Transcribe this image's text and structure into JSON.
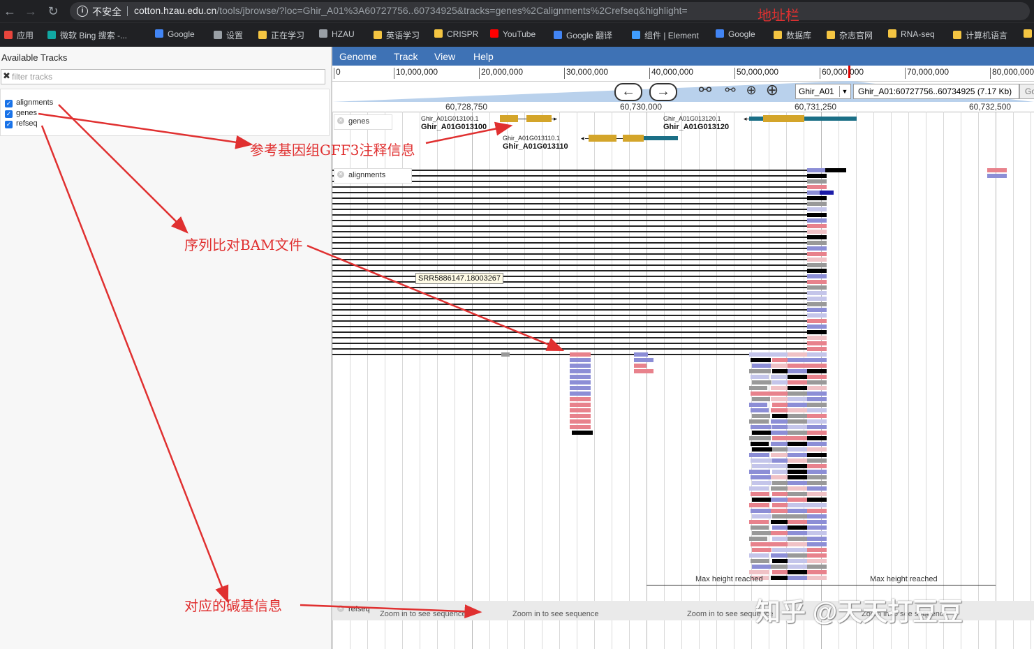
{
  "browser": {
    "security_label": "不安全",
    "url_host": "cotton.hzau.edu.cn",
    "url_rest": "/tools/jbrowse/?loc=Ghir_A01%3A60727756..60734925&tracks=genes%2Calignments%2Crefseq&highlight=",
    "bookmarks": [
      {
        "label": "应用",
        "icon": "apps-grid-icon",
        "color": "#e8453c"
      },
      {
        "label": "微软 Bing 搜索 -...",
        "icon": "bing-icon",
        "color": "#11a7a2"
      },
      {
        "label": "Google",
        "icon": "google-icon",
        "color": "#4285f4"
      },
      {
        "label": "设置",
        "icon": "gear-icon",
        "color": "#9aa0a6"
      },
      {
        "label": "正在学习",
        "icon": "folder-icon",
        "color": "#f4c542"
      },
      {
        "label": "HZAU",
        "icon": "globe-icon",
        "color": "#9aa0a6"
      },
      {
        "label": "英语学习",
        "icon": "folder-icon",
        "color": "#f4c542"
      },
      {
        "label": "CRISPR",
        "icon": "folder-icon",
        "color": "#f4c542"
      },
      {
        "label": "YouTube",
        "icon": "youtube-icon",
        "color": "#ff0000"
      },
      {
        "label": "Google 翻译",
        "icon": "translate-icon",
        "color": "#4285f4"
      },
      {
        "label": "组件 | Element",
        "icon": "element-icon",
        "color": "#409eff"
      },
      {
        "label": "Google",
        "icon": "google-icon",
        "color": "#4285f4"
      },
      {
        "label": "数据库",
        "icon": "folder-icon",
        "color": "#f4c542"
      },
      {
        "label": "杂志官网",
        "icon": "folder-icon",
        "color": "#f4c542"
      },
      {
        "label": "RNA-seq",
        "icon": "folder-icon",
        "color": "#f4c542"
      },
      {
        "label": "计算机语言",
        "icon": "folder-icon",
        "color": "#f4c542"
      }
    ]
  },
  "left_panel": {
    "title": "Available Tracks",
    "filter_placeholder": "filter tracks",
    "tracks": [
      {
        "label": "alignments",
        "checked": true
      },
      {
        "label": "genes",
        "checked": true
      },
      {
        "label": "refseq",
        "checked": true
      }
    ]
  },
  "menu": [
    "Genome",
    "Track",
    "View",
    "Help"
  ],
  "overview_ticks": [
    "0",
    "10,000,000",
    "20,000,000",
    "30,000,000",
    "40,000,000",
    "50,000,000",
    "60,000,000",
    "70,000,000",
    "80,000,000"
  ],
  "nav": {
    "ref_seq": "Ghir_A01",
    "location": "Ghir_A01:60727756..60734925 (7.17 Kb)",
    "go_label": "Go"
  },
  "ruler_labels": [
    "60,728,750",
    "60,730,000",
    "60,731,250",
    "60,732,500"
  ],
  "track_names": {
    "genes": "genes",
    "alignments": "alignments",
    "refseq": "refseq"
  },
  "genes": [
    {
      "transcript": "Ghir_A01G013100.1",
      "gene": "Ghir_A01G013100"
    },
    {
      "transcript": "Ghir_A01G013110.1",
      "gene": "Ghir_A01G013110"
    },
    {
      "transcript": "Ghir_A01G013120.1",
      "gene": "Ghir_A01G013120"
    }
  ],
  "tooltip": "SRR5886147.18003267",
  "max_height_text": "Max height reached",
  "zoom_text": "Zoom in to see sequence",
  "annotations": {
    "address_bar": "地址栏",
    "gff3": "参考基因组GFF3注释信息",
    "bam": "序列比对BAM文件",
    "bases": "对应的碱基信息"
  },
  "watermark": "知乎 @天天打豆豆",
  "colors": {
    "menubar": "#3e72b5",
    "exon": "#d4a52a",
    "utr": "#1b6f86",
    "annotation_red": "#e03030",
    "read_pink": "#e8828c",
    "read_blue": "#8c8ed6",
    "read_gray": "#999999"
  }
}
